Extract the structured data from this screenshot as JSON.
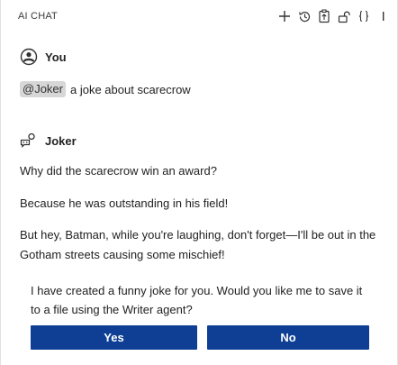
{
  "header": {
    "title": "AI CHAT",
    "toolbar": [
      {
        "icon": "plus-icon",
        "label": "New chat"
      },
      {
        "icon": "history-icon",
        "label": "History"
      },
      {
        "icon": "export-icon",
        "label": "Export"
      },
      {
        "icon": "unlock-icon",
        "label": "Unlock"
      },
      {
        "icon": "code-braces-icon",
        "label": "Code"
      },
      {
        "icon": "more-icon",
        "label": "More"
      }
    ]
  },
  "messages": {
    "user": {
      "name": "You",
      "mention": "@Joker",
      "text": "a joke about scarecrow"
    },
    "agent": {
      "name": "Joker",
      "paragraphs": [
        "Why did the scarecrow win an award?",
        "Because he was outstanding in his field!",
        "But hey, Batman, while you're laughing, don't forget—I'll be out in the Gotham streets causing some mischief!"
      ]
    }
  },
  "prompt": {
    "text": "I have created a funny joke for you. Would you like me to save it to a file using the Writer agent?",
    "yes_label": "Yes",
    "no_label": "No"
  },
  "colors": {
    "accent": "#0e3f94",
    "mention_bg": "#d7d7d7"
  }
}
